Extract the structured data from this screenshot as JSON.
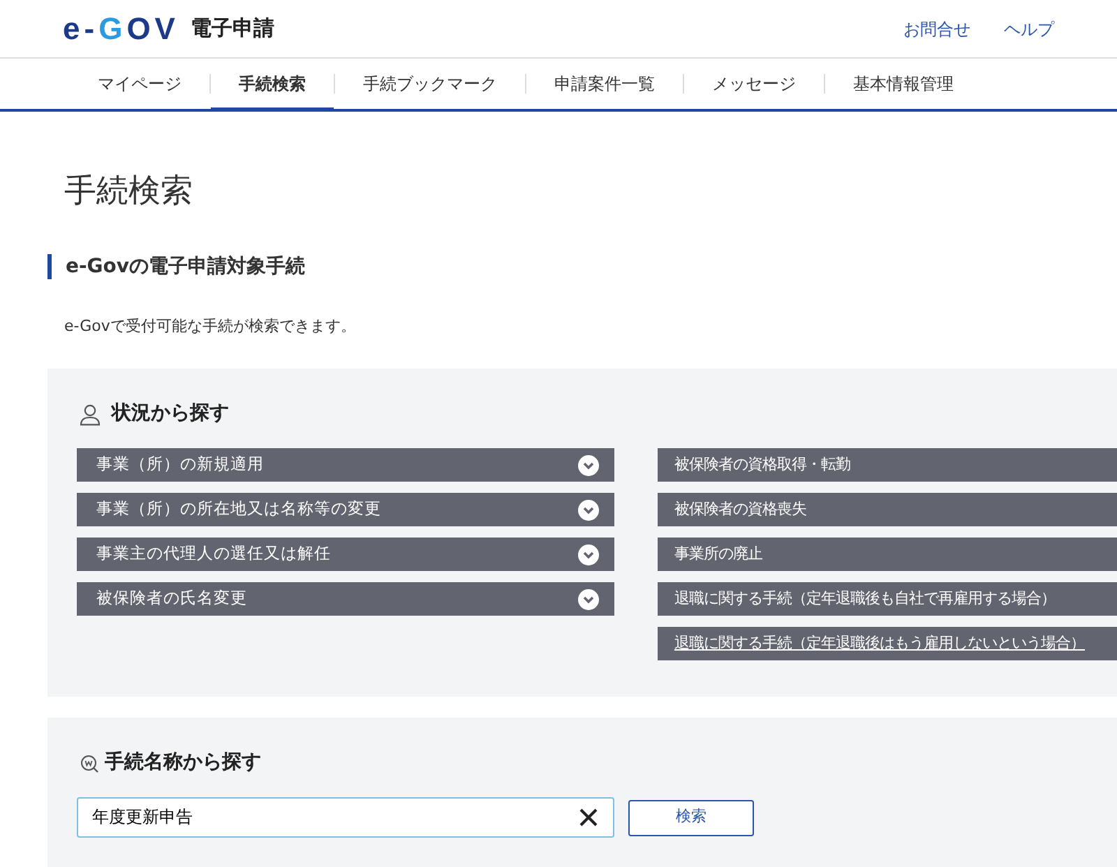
{
  "header": {
    "logo_parts": [
      {
        "text": "e-",
        "color": "#1d3a8a"
      },
      {
        "text": "G",
        "color": "#2a9be0"
      },
      {
        "text": "OV",
        "color": "#1d3a8a"
      }
    ],
    "service": "電子申請",
    "links": [
      "お問合せ",
      "ヘルプ"
    ]
  },
  "tabs": [
    {
      "label": "マイページ",
      "selected": false
    },
    {
      "label": "手続検索",
      "selected": true
    },
    {
      "label": "手続ブックマーク",
      "selected": false
    },
    {
      "label": "申請案件一覧",
      "selected": false
    },
    {
      "label": "メッセージ",
      "selected": false
    },
    {
      "label": "基本情報管理",
      "selected": false
    }
  ],
  "page_title": "手続検索",
  "section_heading": "e-Govの電子申請対象手続",
  "description": "e-Govで受付可能な手続が検索できます。",
  "situation_panel": {
    "heading": "状況から探す",
    "left_items": [
      {
        "label": "事業（所）の新規適用",
        "expandable": true,
        "hovered": false
      },
      {
        "label": "事業（所）の所在地又は名称等の変更",
        "expandable": true,
        "hovered": false
      },
      {
        "label": "事業主の代理人の選任又は解任",
        "expandable": true,
        "hovered": false
      },
      {
        "label": "被保険者の氏名変更",
        "expandable": true,
        "hovered": false
      }
    ],
    "right_items": [
      {
        "label": "被保険者の資格取得・転勤",
        "hovered": false
      },
      {
        "label": "被保険者の資格喪失",
        "hovered": false
      },
      {
        "label": "事業所の廃止",
        "hovered": false
      },
      {
        "label": "退職に関する手続（定年退職後も自社で再雇用する場合）",
        "hovered": false
      },
      {
        "label": "退職に関する手続（定年退職後はもう雇用しないという場合）",
        "hovered": true
      }
    ]
  },
  "name_panel": {
    "heading": "手続名称から探す",
    "search_value": "年度更新申告",
    "button": "検索"
  }
}
